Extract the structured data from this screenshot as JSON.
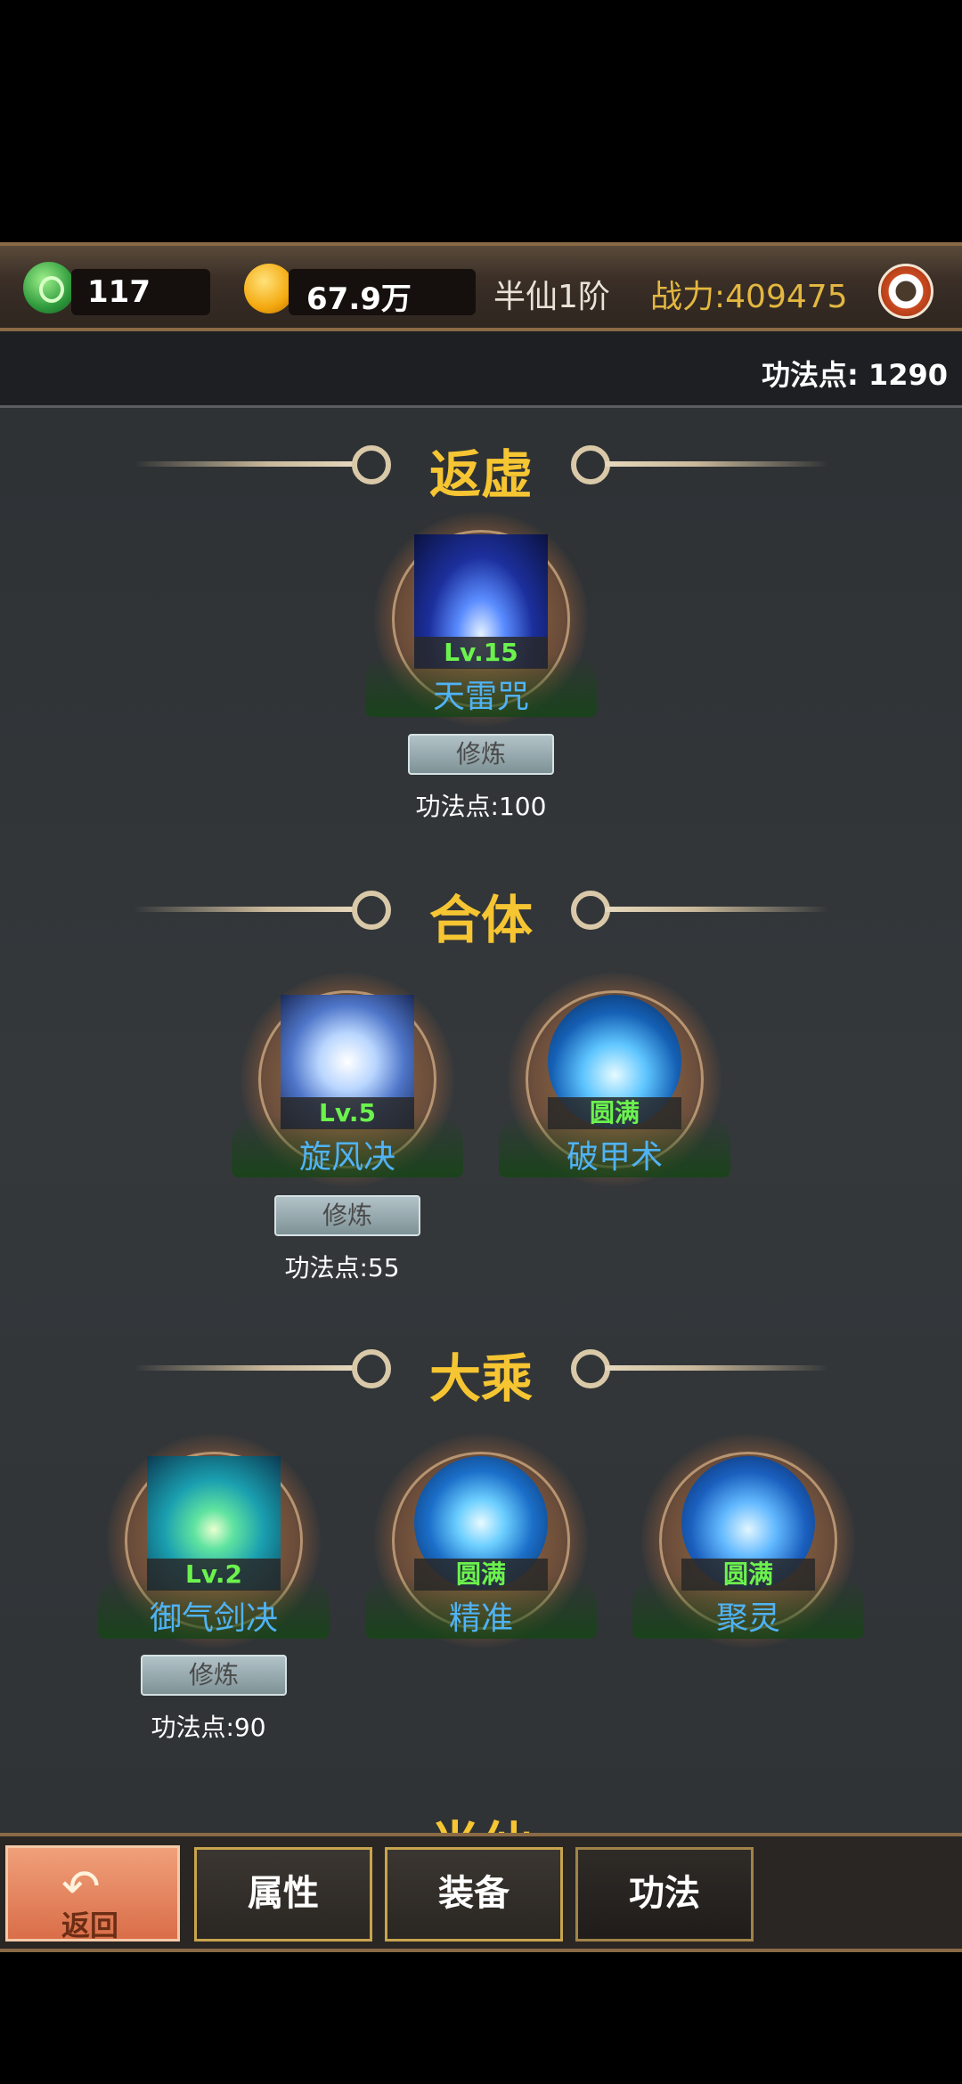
{
  "header": {
    "jade_count": "117",
    "gold_amount": "67.9万",
    "rank": "半仙1阶",
    "combat_power": "战力:409475",
    "skill_points": "功法点:  1290"
  },
  "sections": [
    {
      "title": "返虚",
      "skills": [
        {
          "name": "天雷咒",
          "level": "Lv.15",
          "train_label": "修炼",
          "cost": "功法点:100"
        }
      ]
    },
    {
      "title": "合体",
      "skills": [
        {
          "name": "旋风决",
          "level": "Lv.5",
          "train_label": "修炼",
          "cost": "功法点:55"
        },
        {
          "name": "破甲术",
          "level": "圆满"
        }
      ]
    },
    {
      "title": "大乘",
      "skills": [
        {
          "name": "御气剑决",
          "level": "Lv.2",
          "train_label": "修炼",
          "cost": "功法点:90"
        },
        {
          "name": "精准",
          "level": "圆满"
        },
        {
          "name": "聚灵",
          "level": "圆满"
        }
      ]
    },
    {
      "title": "半仙"
    }
  ],
  "bottom_nav": {
    "back_label": "返回",
    "tabs": [
      "属性",
      "装备",
      "功法"
    ]
  },
  "colors": {
    "section_title": "#f6c532",
    "skill_name": "#4fb3f5",
    "level_text": "#6cf24d",
    "power_text": "#e3b740"
  }
}
